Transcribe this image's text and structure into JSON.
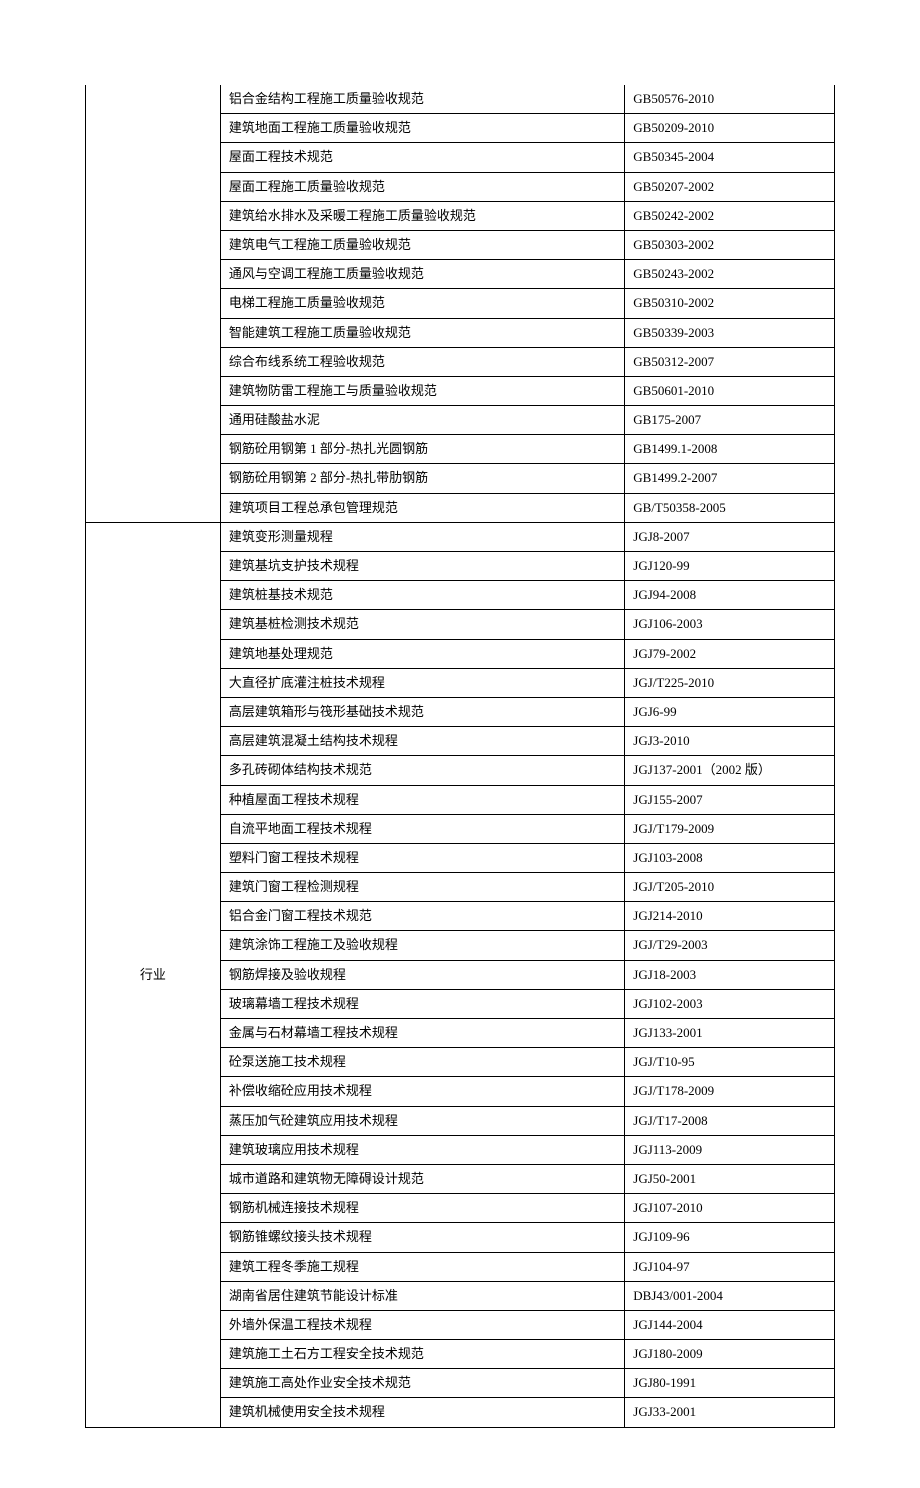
{
  "groups": [
    {
      "category": "",
      "noTopBorder": true,
      "rows": [
        {
          "name": "铝合金结构工程施工质量验收规范",
          "code": "GB50576-2010"
        },
        {
          "name": "建筑地面工程施工质量验收规范",
          "code": "GB50209-2010"
        },
        {
          "name": "屋面工程技术规范",
          "code": "GB50345-2004"
        },
        {
          "name": "屋面工程施工质量验收规范",
          "code": "GB50207-2002"
        },
        {
          "name": "建筑给水排水及采暖工程施工质量验收规范",
          "code": "GB50242-2002"
        },
        {
          "name": "建筑电气工程施工质量验收规范",
          "code": "GB50303-2002"
        },
        {
          "name": "通风与空调工程施工质量验收规范",
          "code": "GB50243-2002"
        },
        {
          "name": "电梯工程施工质量验收规范",
          "code": "GB50310-2002"
        },
        {
          "name": "智能建筑工程施工质量验收规范",
          "code": "GB50339-2003"
        },
        {
          "name": "综合布线系统工程验收规范",
          "code": "GB50312-2007"
        },
        {
          "name": "建筑物防雷工程施工与质量验收规范",
          "code": "GB50601-2010"
        },
        {
          "name": "通用硅酸盐水泥",
          "code": "GB175-2007"
        },
        {
          "name": "钢筋砼用钢第 1 部分-热扎光圆钢筋",
          "code": "GB1499.1-2008"
        },
        {
          "name": "钢筋砼用钢第 2 部分-热扎带肋钢筋",
          "code": "GB1499.2-2007"
        },
        {
          "name": "建筑项目工程总承包管理规范",
          "code": "GB/T50358-2005"
        }
      ]
    },
    {
      "category": "行业",
      "noTopBorder": false,
      "rows": [
        {
          "name": "建筑变形测量规程",
          "code": "JGJ8-2007"
        },
        {
          "name": "建筑基坑支护技术规程",
          "code": "JGJ120-99"
        },
        {
          "name": "建筑桩基技术规范",
          "code": "JGJ94-2008"
        },
        {
          "name": "建筑基桩检测技术规范",
          "code": "JGJ106-2003"
        },
        {
          "name": "建筑地基处理规范",
          "code": "JGJ79-2002"
        },
        {
          "name": "大直径扩底灌注桩技术规程",
          "code": "JGJ/T225-2010"
        },
        {
          "name": "高层建筑箱形与筏形基础技术规范",
          "code": "JGJ6-99"
        },
        {
          "name": "高层建筑混凝土结构技术规程",
          "code": "JGJ3-2010"
        },
        {
          "name": "多孔砖砌体结构技术规范",
          "code": "JGJ137-2001（2002 版）"
        },
        {
          "name": "种植屋面工程技术规程",
          "code": "JGJ155-2007"
        },
        {
          "name": "自流平地面工程技术规程",
          "code": "JGJ/T179-2009"
        },
        {
          "name": "塑料门窗工程技术规程",
          "code": "JGJ103-2008"
        },
        {
          "name": "建筑门窗工程检测规程",
          "code": "JGJ/T205-2010"
        },
        {
          "name": "铝合金门窗工程技术规范",
          "code": "JGJ214-2010"
        },
        {
          "name": "建筑涂饰工程施工及验收规程",
          "code": "JGJ/T29-2003"
        },
        {
          "name": "钢筋焊接及验收规程",
          "code": "JGJ18-2003"
        },
        {
          "name": "玻璃幕墙工程技术规程",
          "code": "JGJ102-2003"
        },
        {
          "name": "金属与石材幕墙工程技术规程",
          "code": "JGJ133-2001"
        },
        {
          "name": "砼泵送施工技术规程",
          "code": "JGJ/T10-95"
        },
        {
          "name": "补偿收缩砼应用技术规程",
          "code": "JGJ/T178-2009"
        },
        {
          "name": "蒸压加气砼建筑应用技术规程",
          "code": "JGJ/T17-2008"
        },
        {
          "name": "建筑玻璃应用技术规程",
          "code": "JGJ113-2009"
        },
        {
          "name": "城市道路和建筑物无障碍设计规范",
          "code": "JGJ50-2001"
        },
        {
          "name": "钢筋机械连接技术规程",
          "code": "JGJ107-2010"
        },
        {
          "name": "钢筋锥螺纹接头技术规程",
          "code": "JGJ109-96"
        },
        {
          "name": "建筑工程冬季施工规程",
          "code": "JGJ104-97"
        },
        {
          "name": "湖南省居住建筑节能设计标准",
          "code": "DBJ43/001-2004"
        },
        {
          "name": "外墙外保温工程技术规程",
          "code": "JGJ144-2004"
        },
        {
          "name": "建筑施工土石方工程安全技术规范",
          "code": "JGJ180-2009"
        },
        {
          "name": "建筑施工高处作业安全技术规范",
          "code": "JGJ80-1991"
        },
        {
          "name": "建筑机械使用安全技术规程",
          "code": "JGJ33-2001"
        }
      ]
    }
  ]
}
